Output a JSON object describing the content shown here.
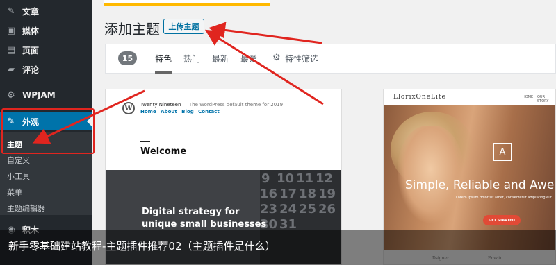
{
  "sidebar": {
    "items": [
      {
        "label": "文章",
        "icon": "pushpin-icon"
      },
      {
        "label": "媒体",
        "icon": "media-icon"
      },
      {
        "label": "页面",
        "icon": "page-icon"
      },
      {
        "label": "评论",
        "icon": "comment-icon"
      },
      {
        "label": "WPJAM",
        "icon": "gear-icon"
      },
      {
        "label": "外观",
        "icon": "paintbrush-icon"
      },
      {
        "label": "积木",
        "icon": "block-icon"
      }
    ],
    "submenu": [
      "主题",
      "自定义",
      "小工具",
      "菜单",
      "主题编辑器"
    ]
  },
  "header": {
    "title": "添加主题",
    "upload_label": "上传主题"
  },
  "filter": {
    "count": "15",
    "tabs": [
      "特色",
      "热门",
      "最新",
      "最爱"
    ],
    "feature_filter": "特性筛选"
  },
  "theme1": {
    "logo": "W",
    "site_title": "Twenty Nineteen",
    "tagline": "— The WordPress default theme for 2019",
    "nav": [
      "Home",
      "About",
      "Blog",
      "Contact"
    ],
    "heading": "Welcome",
    "hero_line1": "Digital strategy for",
    "hero_line2": "unique small businesses",
    "calendar": [
      "9",
      "10",
      "11",
      "12",
      "16",
      "17",
      "18",
      "19",
      "23",
      "24",
      "25",
      "26",
      "30",
      "31"
    ]
  },
  "theme2": {
    "logo": "LlorixOneLite",
    "nav": [
      "HOME",
      "OUR STORY"
    ],
    "emblem": "A",
    "headline": "Simple, Reliable and Awe",
    "subtext": "Lorem ipsum dolor sit amet, consectetur adipiscing elit.",
    "cta": "GET STARTED",
    "brands": [
      "Dsigner",
      "Envato"
    ]
  },
  "caption": "新手零基础建站教程-主题插件推荐02（主题插件是什么）",
  "colors": {
    "sidebar_bg": "#23282d",
    "active_bg": "#0073aa",
    "annotation_red": "#e0251f",
    "upload_border": "#0071a1"
  }
}
